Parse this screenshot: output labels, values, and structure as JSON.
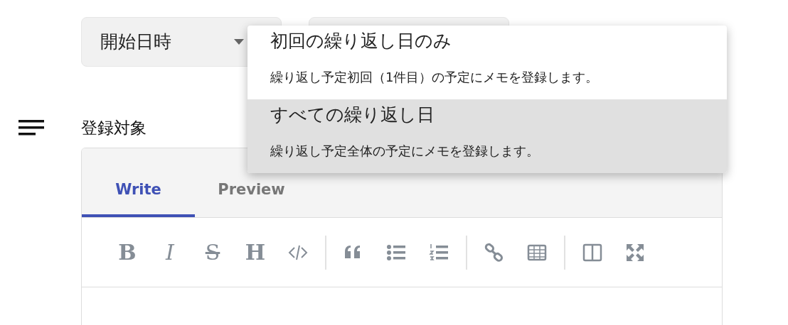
{
  "select": {
    "value": "開始日時"
  },
  "menu": {
    "items": [
      {
        "title": "初回の繰り返し日のみ",
        "description": "繰り返し予定初回（1件目）の予定にメモを登録します。",
        "selected": false
      },
      {
        "title": "すべての繰り返し日",
        "description": "繰り返し予定全体の予定にメモを登録します。",
        "selected": true
      }
    ]
  },
  "section_label": "登録対象",
  "editor": {
    "tabs": [
      {
        "label": "Write",
        "selected": true
      },
      {
        "label": "Preview",
        "selected": false
      }
    ],
    "toolbar_glyphs": [
      "B",
      "I",
      "S",
      "H"
    ]
  }
}
